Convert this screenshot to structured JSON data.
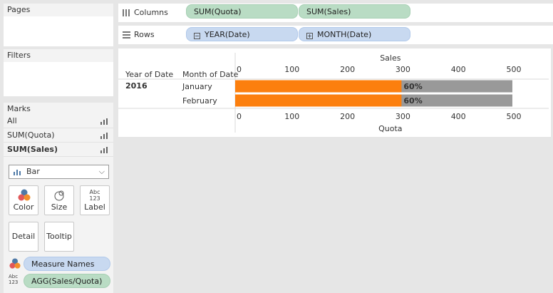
{
  "pages": {
    "title": "Pages"
  },
  "filters": {
    "title": "Filters"
  },
  "marks": {
    "title": "Marks",
    "cards": [
      {
        "label": "All",
        "bold": false
      },
      {
        "label": "SUM(Quota)",
        "bold": false
      },
      {
        "label": "SUM(Sales)",
        "bold": true
      }
    ],
    "mark_type": "Bar",
    "buttons": {
      "color": "Color",
      "size": "Size",
      "label": "Label",
      "detail": "Detail",
      "tooltip": "Tooltip"
    },
    "abc_text": "Abc",
    "num_text": "123",
    "fields": [
      {
        "label": "Measure Names",
        "kind": "color"
      },
      {
        "label": "AGG(Sales/Quota)",
        "kind": "label"
      }
    ]
  },
  "shelves": {
    "columns": {
      "label": "Columns",
      "pills": [
        "SUM(Quota)",
        "SUM(Sales)"
      ]
    },
    "rows": {
      "label": "Rows",
      "pills": [
        "YEAR(Date)",
        "MONTH(Date)"
      ]
    }
  },
  "colors": {
    "sales": "#fc7f0e",
    "quota": "#999999",
    "pill_green": "#b9dcc4",
    "pill_blue": "#c8d9f0"
  },
  "chart_data": {
    "type": "bar",
    "orientation": "horizontal",
    "row_headers": [
      "Year of Date",
      "Month of Date"
    ],
    "year": "2016",
    "categories": [
      "January",
      "February"
    ],
    "series": [
      {
        "name": "Quota",
        "values": [
          500,
          500
        ],
        "color": "#999999"
      },
      {
        "name": "Sales",
        "values": [
          300,
          300
        ],
        "color": "#fc7f0e"
      }
    ],
    "data_labels": [
      "60%",
      "60%"
    ],
    "top_axis_title": "Sales",
    "bottom_axis_title": "Quota",
    "ticks": [
      0,
      100,
      200,
      300,
      400,
      500
    ],
    "xlim": [
      0,
      560
    ],
    "grid": false
  }
}
